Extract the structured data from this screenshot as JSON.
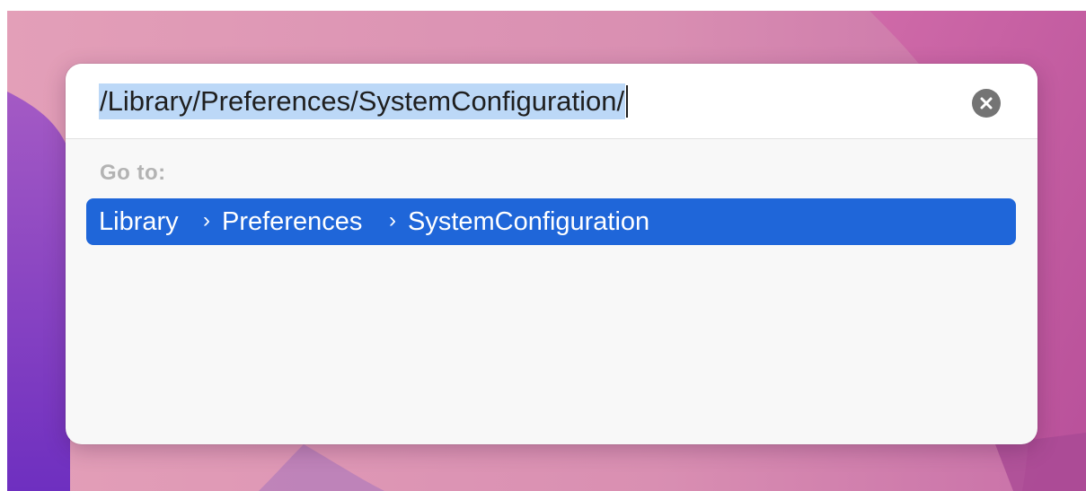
{
  "go_to_folder": {
    "path_input_value": "/Library/Preferences/SystemConfiguration/",
    "clear_icon": "x-circle-icon",
    "goto_label": "Go to:",
    "result": {
      "crumbs": [
        "Library",
        "Preferences",
        "SystemConfiguration"
      ],
      "separator": "›"
    }
  },
  "colors": {
    "selection_highlight": "#bcd8f7",
    "selected_row": "#1f66d9",
    "clear_button": "#747474"
  }
}
